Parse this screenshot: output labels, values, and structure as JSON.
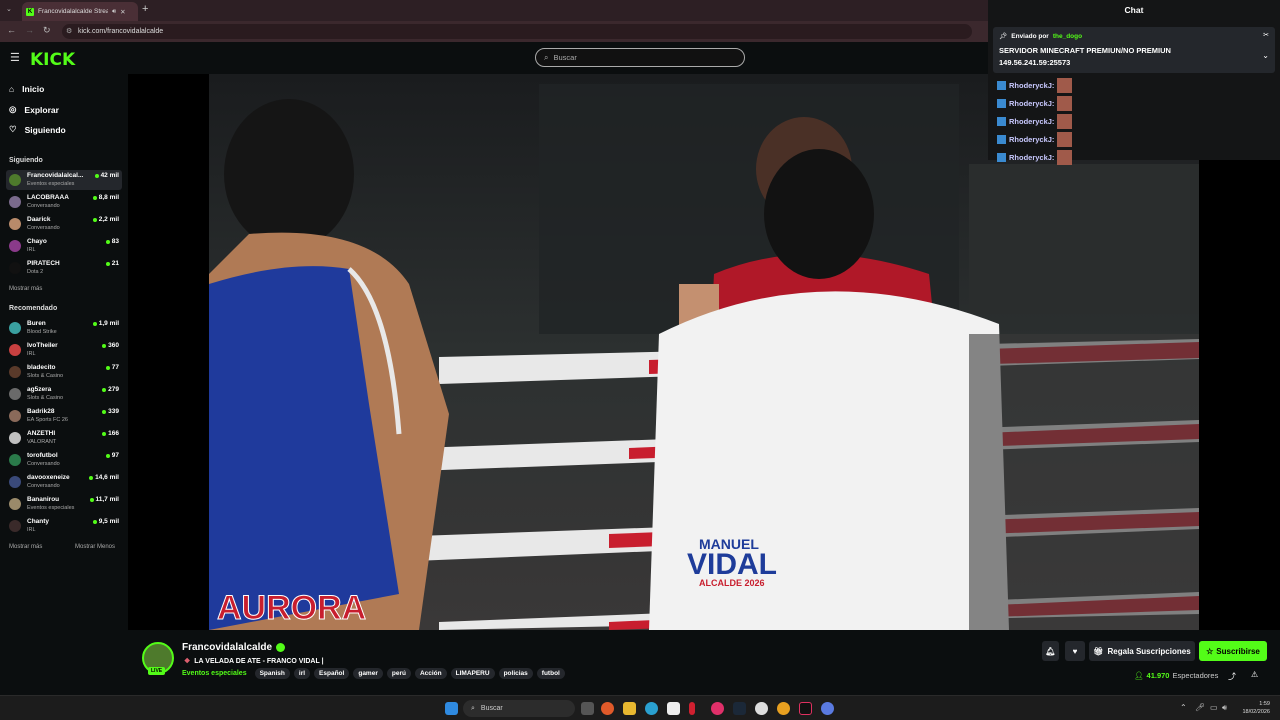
{
  "browser": {
    "tab_title": "Francovidalalcalde Stream",
    "url": "kick.com/francovidalalcalde"
  },
  "header": {
    "logo": "KICK",
    "search_placeholder": "Buscar"
  },
  "sidebar": {
    "nav": [
      {
        "label": "Inicio",
        "icon": "home-icon"
      },
      {
        "label": "Explorar",
        "icon": "compass-icon"
      },
      {
        "label": "Siguiendo",
        "icon": "heart-icon"
      }
    ],
    "following_title": "Siguiendo",
    "following": [
      {
        "name": "Francovidalalcal...",
        "category": "Eventos especiales",
        "viewers": "42 mil",
        "color": "#4e7a2c"
      },
      {
        "name": "LACOBRAAA",
        "category": "Conversando",
        "viewers": "8,8 mil",
        "color": "#7a6a8c"
      },
      {
        "name": "Daarick",
        "category": "Conversando",
        "viewers": "2,2 mil",
        "color": "#b88a6a"
      },
      {
        "name": "Chayo",
        "category": "IRL",
        "viewers": "83",
        "color": "#8a3a8a"
      },
      {
        "name": "PIRATECH",
        "category": "Dota 2",
        "viewers": "21",
        "color": "#111111"
      }
    ],
    "following_more": "Mostrar más",
    "recommended_title": "Recomendado",
    "recommended": [
      {
        "name": "Buren",
        "category": "Blood Strike",
        "viewers": "1,9 mil",
        "color": "#3aa0a0"
      },
      {
        "name": "IvoTheiler",
        "category": "IRL",
        "viewers": "360",
        "color": "#c84040"
      },
      {
        "name": "bladecito",
        "category": "Slots & Casino",
        "viewers": "77",
        "color": "#5a3a2a"
      },
      {
        "name": "ag5zera",
        "category": "Slots & Casino",
        "viewers": "279",
        "color": "#6a6a6a"
      },
      {
        "name": "Badrik28",
        "category": "EA Sports FC 26",
        "viewers": "339",
        "color": "#8a6a5a"
      },
      {
        "name": "ANZETHI",
        "category": "VALORANT",
        "viewers": "166",
        "color": "#c0c0c0"
      },
      {
        "name": "torofutbol",
        "category": "Conversando",
        "viewers": "97",
        "color": "#2a7a4a"
      },
      {
        "name": "davooxeneize",
        "category": "Conversando",
        "viewers": "14,6 mil",
        "color": "#3a4a7a"
      },
      {
        "name": "Bananirou",
        "category": "Eventos especiales",
        "viewers": "11,7 mil",
        "color": "#9a8a6a"
      },
      {
        "name": "Chanty",
        "category": "IRL",
        "viewers": "9,5 mil",
        "color": "#3a2a2a"
      }
    ],
    "show_more": "Mostrar más",
    "show_less": "Mostrar Menos"
  },
  "chat": {
    "title": "Chat",
    "pinned_label": "Enviado por",
    "pinned_user": "the_dogo",
    "pinned_line1": "SERVIDOR MINECRAFT PREMIUN/NO PREMIUN",
    "pinned_line2": "149.56.241.59:25573",
    "messages": [
      "RhoderyckJ:",
      "RhoderyckJ:",
      "RhoderyckJ:",
      "RhoderyckJ:",
      "RhoderyckJ:"
    ]
  },
  "video": {
    "overlay_line1": "MANUEL",
    "overlay_line2": "VIDAL",
    "overlay_line3": "ALCALDE 2026",
    "banner_text": "AURORA"
  },
  "stream": {
    "channel_name": "Francovidalalcalde",
    "title": "LA VELADA DE ATE - FRANCO VIDAL |",
    "category": "Eventos especiales",
    "tags": [
      "Spanish",
      "irl",
      "Español",
      "gamer",
      "perú",
      "Acción",
      "LIMAPERU",
      "policias",
      "futbol"
    ],
    "live_badge": "LIVE",
    "viewers": "41.970",
    "viewers_label": "Espectadores"
  },
  "actions": {
    "gift_subs": "Regala Suscripciones",
    "subscribe": "Suscribirse"
  },
  "taskbar": {
    "search_placeholder": "Buscar",
    "time": "1:59",
    "date": "18/02/2026"
  },
  "colors": {
    "accent": "#53fc18",
    "background": "#0b0e0f",
    "panel": "#24272c"
  }
}
